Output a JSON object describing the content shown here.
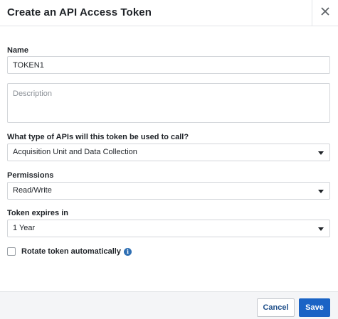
{
  "dialog": {
    "title": "Create an API Access Token",
    "close_icon": "close-icon"
  },
  "form": {
    "name": {
      "label": "Name",
      "value": "TOKEN1"
    },
    "description": {
      "placeholder": "Description",
      "value": ""
    },
    "api_type": {
      "label": "What type of APIs will this token be used to call?",
      "value": "Acquisition Unit and Data Collection"
    },
    "permissions": {
      "label": "Permissions",
      "value": "Read/Write"
    },
    "expiry": {
      "label": "Token expires in",
      "value": "1 Year"
    },
    "rotate": {
      "label": "Rotate token automatically",
      "checked": false,
      "info_icon": "info-icon"
    }
  },
  "footer": {
    "cancel_label": "Cancel",
    "save_label": "Save"
  },
  "colors": {
    "primary": "#1a63c5",
    "info": "#2f6fb3",
    "footer_bg": "#f4f5f7"
  }
}
